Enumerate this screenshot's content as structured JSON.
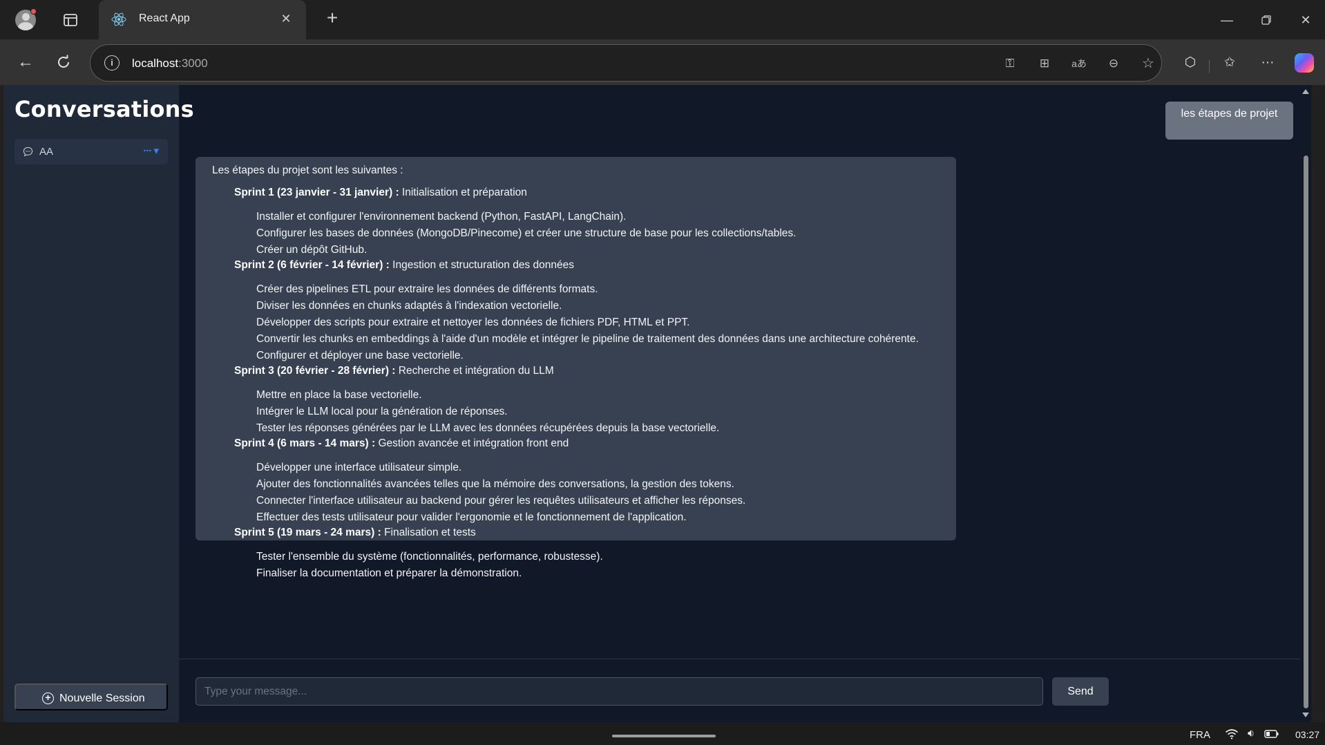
{
  "browser": {
    "tab_title": "React App",
    "tab_close": "✕",
    "new_tab": "+",
    "url_host": "localhost",
    "url_port": ":3000",
    "info_glyph": "i"
  },
  "sidebar": {
    "title": "Conversations",
    "conversations": [
      {
        "label": "AA",
        "menu": "··· ▾"
      }
    ],
    "new_session_label": "Nouvelle Session"
  },
  "chat": {
    "user_message": "les étapes de projet",
    "assistant": {
      "intro": "Les étapes du projet sont les suivantes :",
      "sprints": [
        {
          "title": "Sprint 1 (23 janvier - 31 janvier) :",
          "subtitle": " Initialisation et préparation",
          "items": [
            "Installer et configurer l'environnement backend (Python, FastAPI, LangChain).",
            "Configurer les bases de données (MongoDB/Pinecome) et créer une structure de base pour les collections/tables.",
            "Créer un dépôt GitHub."
          ]
        },
        {
          "title": "Sprint 2 (6 février - 14 février) :",
          "subtitle": " Ingestion et structuration des données",
          "items": [
            "Créer des pipelines ETL pour extraire les données de différents formats.",
            "Diviser les données en chunks adaptés à l'indexation vectorielle.",
            "Développer des scripts pour extraire et nettoyer les données de fichiers PDF, HTML et PPT.",
            "Convertir les chunks en embeddings à l'aide d'un modèle et intégrer le pipeline de traitement des données dans une architecture cohérente.",
            "Configurer et déployer une base vectorielle."
          ]
        },
        {
          "title": "Sprint 3 (20 février - 28 février) :",
          "subtitle": " Recherche et intégration du LLM",
          "items": [
            "Mettre en place la base vectorielle.",
            "Intégrer le LLM local pour la génération de réponses.",
            "Tester les réponses générées par le LLM avec les données récupérées depuis la base vectorielle."
          ]
        },
        {
          "title": "Sprint 4 (6 mars - 14 mars) :",
          "subtitle": " Gestion avancée et intégration front end",
          "items": [
            "Développer une interface utilisateur simple.",
            "Ajouter des fonctionnalités avancées telles que la mémoire des conversations, la gestion des tokens.",
            "Connecter l'interface utilisateur au backend pour gérer les requêtes utilisateurs et afficher les réponses.",
            "Effectuer des tests utilisateur pour valider l'ergonomie et le fonctionnement de l'application."
          ]
        },
        {
          "title": "Sprint 5 (19 mars - 24 mars) :",
          "subtitle": " Finalisation et tests",
          "items": [
            "Tester l'ensemble du système (fonctionnalités, performance, robustesse).",
            "Finaliser la documentation et préparer la démonstration."
          ]
        }
      ]
    },
    "input_placeholder": "Type your message...",
    "send_label": "Send"
  },
  "taskbar": {
    "language": "FRA",
    "time": "03:27"
  },
  "colors": {
    "page_bg": "#111827",
    "sidebar_bg": "#1f2937",
    "assistant_bubble": "#374151",
    "user_bubble": "#6b7280",
    "accent": "#3b82f6"
  }
}
